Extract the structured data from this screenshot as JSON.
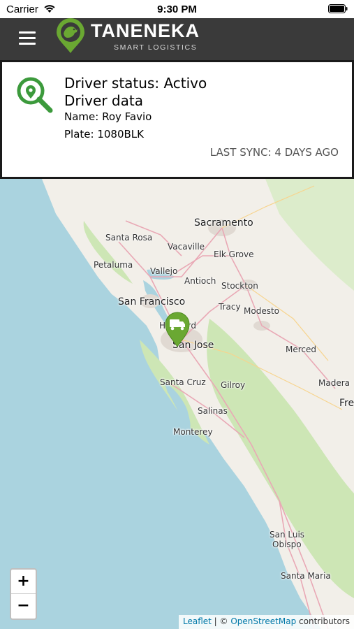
{
  "status_bar": {
    "carrier": "Carrier",
    "time": "9:30 PM"
  },
  "header": {
    "brand": "TANENEKA",
    "tagline": "SMART LOGISTICS",
    "icons": [
      "menu-icon",
      "logo-pin-icon"
    ]
  },
  "driver_card": {
    "status_line": "Driver status: Activo",
    "data_heading": "Driver data",
    "name_line": "Name: Roy Favio",
    "plate_line": "Plate: 1080BLK",
    "last_sync": "LAST SYNC: 4 DAYS AGO",
    "icon": "location-search-icon"
  },
  "map": {
    "cities": {
      "sacramento": "Sacramento",
      "santa_rosa": "Santa Rosa",
      "vacaville": "Vacaville",
      "elk_grove": "Elk Grove",
      "petaluma": "Petaluma",
      "vallejo": "Vallejo",
      "antioch": "Antioch",
      "stockton": "Stockton",
      "san_francisco": "San Francisco",
      "tracy": "Tracy",
      "hayward": "Hayward",
      "modesto": "Modesto",
      "san_jose": "San Jose",
      "merced": "Merced",
      "santa_cruz": "Santa Cruz",
      "gilroy": "Gilroy",
      "madera": "Madera",
      "fresno_partial": "Fre",
      "salinas": "Salinas",
      "monterey": "Monterey",
      "san_luis_obispo_1": "San Luis",
      "san_luis_obispo_2": "Obispo",
      "santa_maria": "Santa Maria"
    },
    "marker_icon": "truck-marker-icon",
    "zoom_in": "+",
    "zoom_out": "−",
    "attribution": {
      "leaflet": "Leaflet",
      "sep": " | © ",
      "osm": "OpenStreetMap",
      "suffix": " contributors"
    },
    "colors": {
      "water": "#aad3df",
      "land": "#f2efe9",
      "green": "#cde6b5",
      "urban": "#e0d9d2",
      "roads": "#e9a8b5",
      "marker": "#6aa832"
    }
  }
}
